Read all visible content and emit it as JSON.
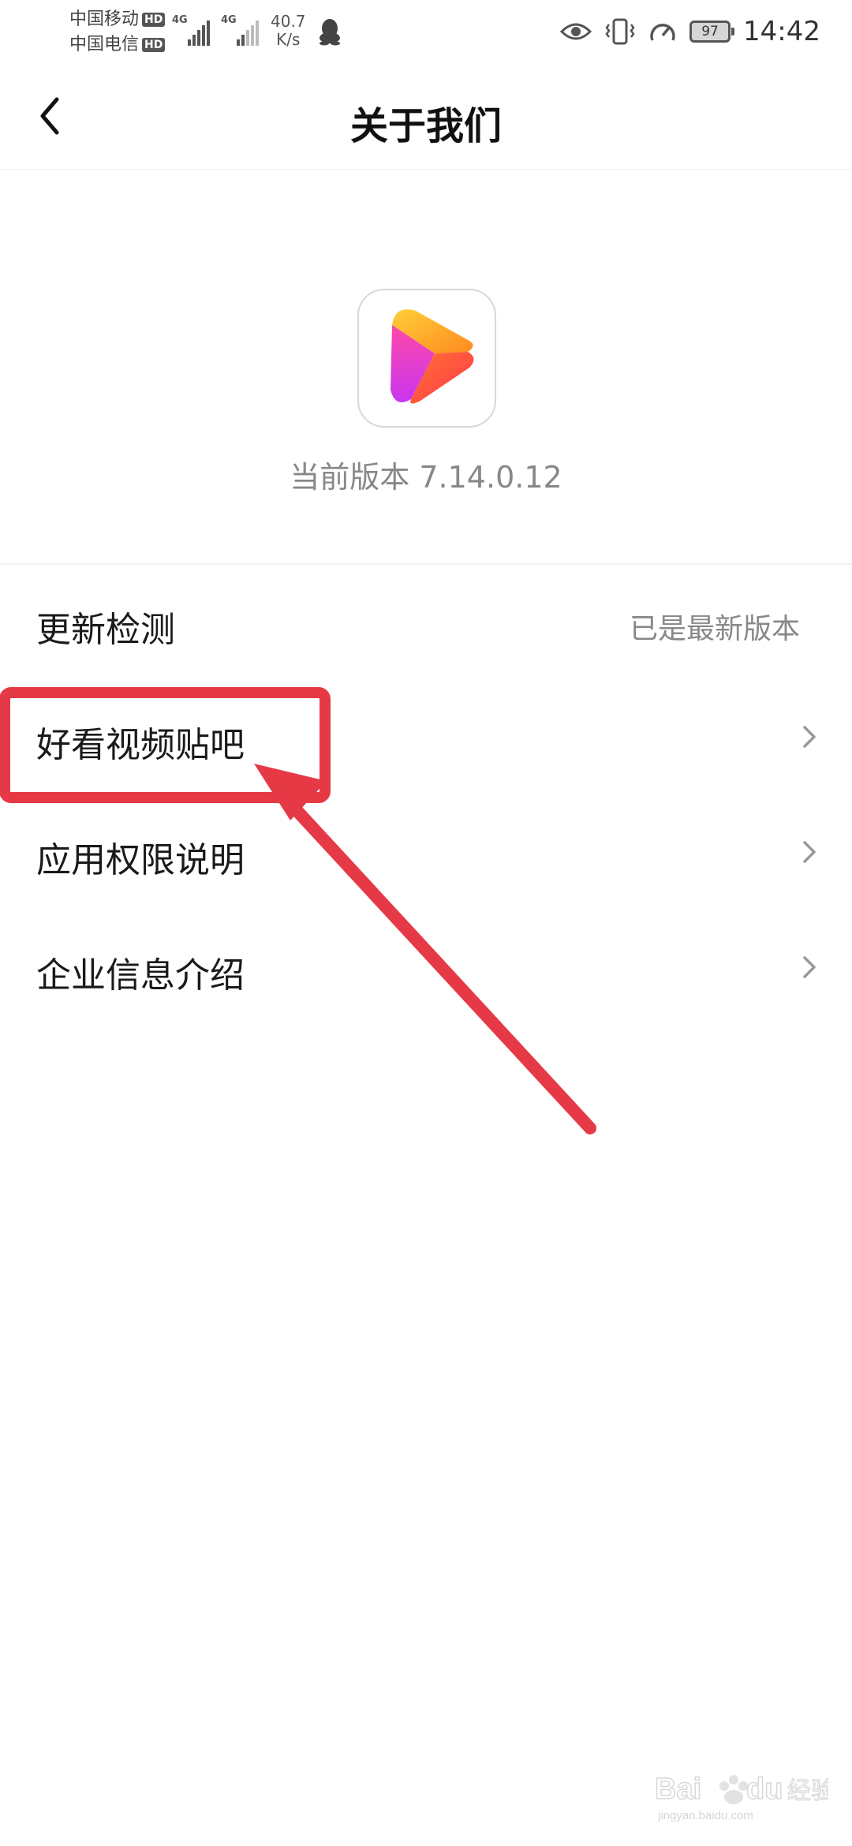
{
  "status_bar": {
    "carrier1": "中国移动",
    "carrier2": "中国电信",
    "hd_badge": "HD",
    "network_type": "4G",
    "speed_value": "40.7",
    "speed_unit": "K/s",
    "battery": "97",
    "time": "14:42",
    "icons": [
      "qq-icon",
      "eye-icon",
      "vibrate-icon",
      "speedometer-icon",
      "battery-icon"
    ]
  },
  "header": {
    "title": "关于我们",
    "back_icon": "chevron-left-icon"
  },
  "app": {
    "icon": "play-logo-icon",
    "version_label": "当前版本 7.14.0.12"
  },
  "menu": {
    "items": [
      {
        "label": "更新检测",
        "value": "已是最新版本"
      },
      {
        "label": "好看视频贴吧",
        "value": ""
      },
      {
        "label": "应用权限说明",
        "value": ""
      },
      {
        "label": "企业信息介绍",
        "value": ""
      }
    ]
  },
  "annotation": {
    "color": "#e63946",
    "target": "好看视频贴吧"
  },
  "watermark": {
    "text": "Baidu经验",
    "url_text": "jingyan.baidu.com"
  },
  "colors": {
    "accent": "#e63946",
    "text_primary": "#1a1a1a",
    "text_secondary": "#888888",
    "chevron": "#999999"
  }
}
